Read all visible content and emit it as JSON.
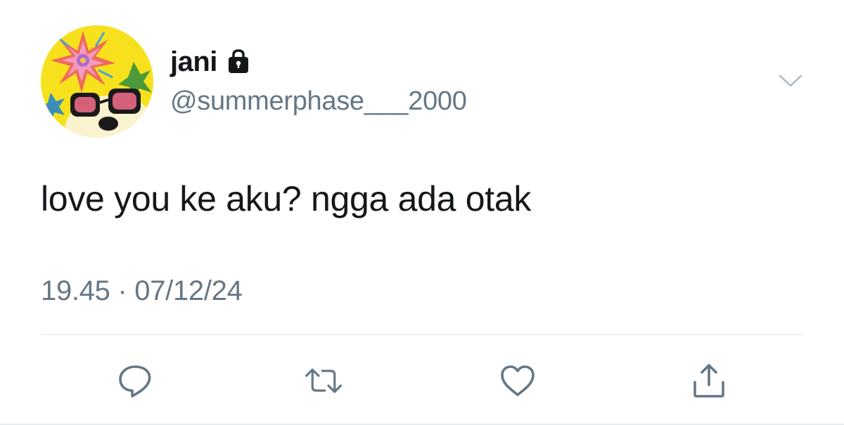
{
  "user": {
    "display_name": "jani",
    "handle": "@summerphase___2000",
    "avatar": "avatar-illustration",
    "protected_icon": "lock-icon"
  },
  "tweet": {
    "text": "love you ke aku? ngga ada otak",
    "timestamp": "19.45 · 07/12/24"
  },
  "menu": {
    "icon": "chevron-down-icon"
  },
  "actions": [
    {
      "name": "reply",
      "icon": "reply-icon"
    },
    {
      "name": "retweet",
      "icon": "retweet-icon"
    },
    {
      "name": "like",
      "icon": "heart-icon"
    },
    {
      "name": "share",
      "icon": "share-icon"
    }
  ],
  "colors": {
    "text_primary": "#14171a",
    "text_secondary": "#657786",
    "icon": "#657786",
    "divider": "#e1e8ed",
    "background": "#ffffff"
  }
}
